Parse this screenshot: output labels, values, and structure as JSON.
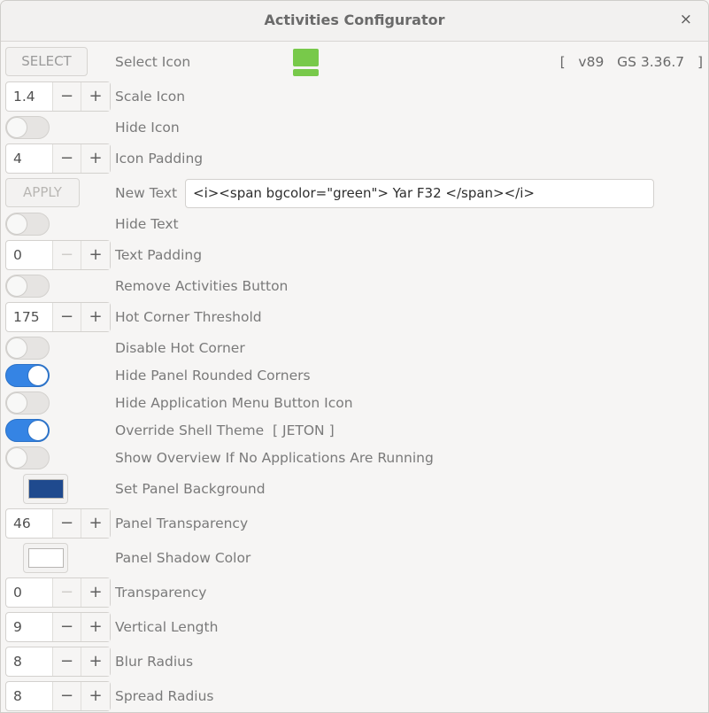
{
  "window": {
    "title": "Activities Configurator"
  },
  "version": {
    "text": "[   v89   GS 3.36.7   ]"
  },
  "colors": {
    "accent": "#3584e4",
    "icon_green": "#78c94a",
    "panel_bg": "#1f4a8e",
    "shadow": "#ffffff"
  },
  "rows": {
    "select_icon": {
      "button": "SELECT",
      "label": "Select Icon"
    },
    "scale_icon": {
      "value": "1.4",
      "label": "Scale Icon"
    },
    "hide_icon": {
      "label": "Hide Icon",
      "on": false
    },
    "icon_padding": {
      "value": "4",
      "label": "Icon Padding"
    },
    "new_text": {
      "button": "APPLY",
      "label": "New Text",
      "value": "<i><span bgcolor=\"green\">  Yar  F32 </span></i>"
    },
    "hide_text": {
      "label": "Hide Text",
      "on": false
    },
    "text_padding": {
      "value": "0",
      "label": "Text Padding"
    },
    "remove_activities": {
      "label": "Remove Activities Button",
      "on": false
    },
    "hot_corner_threshold": {
      "value": "175",
      "label": "Hot Corner Threshold"
    },
    "disable_hot_corner": {
      "label": "Disable Hot Corner",
      "on": false
    },
    "hide_rounded_corners": {
      "label": "Hide Panel Rounded Corners",
      "on": true
    },
    "hide_app_menu_icon": {
      "label": "Hide Application Menu Button Icon",
      "on": false
    },
    "override_theme": {
      "label": "Override Shell Theme  [ JETON ]",
      "on": true
    },
    "show_overview": {
      "label": "Show Overview If No Applications Are Running",
      "on": false
    },
    "panel_background": {
      "label": "Set Panel Background"
    },
    "panel_transparency": {
      "value": "46",
      "label": "Panel Transparency"
    },
    "panel_shadow_color": {
      "label": "Panel Shadow Color"
    },
    "transparency": {
      "value": "0",
      "label": "Transparency"
    },
    "vertical_length": {
      "value": "9",
      "label": "Vertical Length"
    },
    "blur_radius": {
      "value": "8",
      "label": "Blur Radius"
    },
    "spread_radius": {
      "value": "8",
      "label": "Spread Radius"
    }
  },
  "spin_symbols": {
    "minus": "−",
    "plus": "+"
  },
  "close_symbol": "×"
}
